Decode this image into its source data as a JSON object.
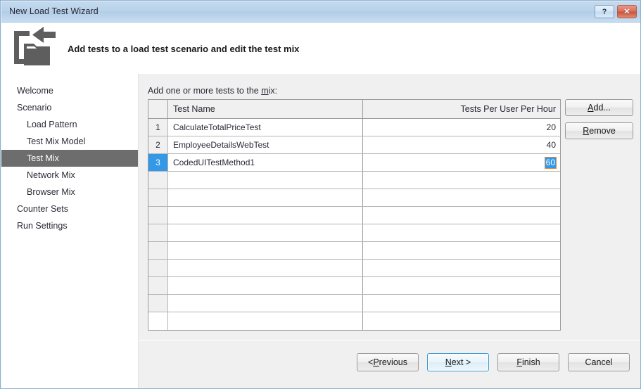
{
  "window": {
    "title": "New Load Test Wizard",
    "help_button": "?",
    "close_button": "✕"
  },
  "banner": {
    "icon": "import-folder-icon",
    "title": "Add tests to a load test scenario and edit the test mix"
  },
  "sidebar": {
    "items": [
      {
        "label": "Welcome",
        "level": 0,
        "selected": false
      },
      {
        "label": "Scenario",
        "level": 0,
        "selected": false
      },
      {
        "label": "Load Pattern",
        "level": 1,
        "selected": false
      },
      {
        "label": "Test Mix Model",
        "level": 1,
        "selected": false
      },
      {
        "label": "Test Mix",
        "level": 1,
        "selected": true
      },
      {
        "label": "Network Mix",
        "level": 1,
        "selected": false
      },
      {
        "label": "Browser Mix",
        "level": 1,
        "selected": false
      },
      {
        "label": "Counter Sets",
        "level": 0,
        "selected": false
      },
      {
        "label": "Run Settings",
        "level": 0,
        "selected": false
      }
    ]
  },
  "main": {
    "instruction_prefix": "Add one or more tests to the ",
    "instruction_accesskey": "m",
    "instruction_suffix": "ix:",
    "grid": {
      "columns": [
        "Test Name",
        "Tests Per User Per Hour"
      ],
      "rows": [
        {
          "num": "1",
          "name": "CalculateTotalPriceTest",
          "rate": "20",
          "selected": false,
          "editing": false
        },
        {
          "num": "2",
          "name": "EmployeeDetailsWebTest",
          "rate": "40",
          "selected": false,
          "editing": false
        },
        {
          "num": "3",
          "name": "CodedUITestMethod1",
          "rate": "60",
          "selected": true,
          "editing": true
        }
      ],
      "empty_row_count": 9
    },
    "buttons": [
      {
        "accesskey": "A",
        "before": "",
        "after": "dd..."
      },
      {
        "accesskey": "R",
        "before": "",
        "after": "emove"
      }
    ]
  },
  "footer": {
    "buttons": [
      {
        "before": "< ",
        "accesskey": "P",
        "after": "revious",
        "focused": false
      },
      {
        "before": "",
        "accesskey": "N",
        "after": "ext >",
        "focused": true
      },
      {
        "before": "",
        "accesskey": "F",
        "after": "inish",
        "focused": false
      },
      {
        "before": "Cancel",
        "accesskey": "",
        "after": "",
        "focused": false
      }
    ]
  },
  "colors": {
    "titlebar": "#bad3ea",
    "accent_selection": "#3399e6",
    "nav_selected": "#6d6d6d",
    "panel": "#f0f0f0",
    "edit_outline": "#e08a3c"
  }
}
